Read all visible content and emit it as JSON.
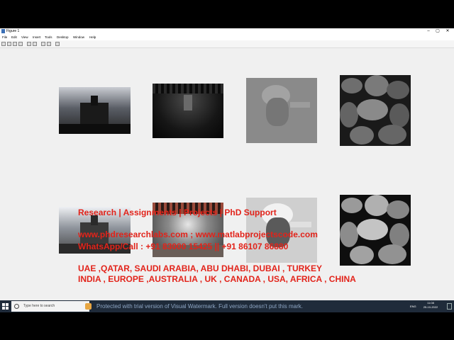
{
  "window": {
    "title": "Figure 1",
    "menu": [
      "File",
      "Edit",
      "View",
      "Insert",
      "Tools",
      "Desktop",
      "Window",
      "Help"
    ],
    "controls": [
      "–",
      "▢",
      "✕"
    ]
  },
  "figure": {
    "row1": [
      "grayscale church photo",
      "dark tunnel bridge",
      "einstein low contrast",
      "coffee beans texture"
    ],
    "row2": [
      "church photo enhanced",
      "bridge enhanced",
      "einstein enhanced",
      "coffee beans enhanced"
    ]
  },
  "overlay": {
    "line1": "Research | Assignments | Projects | PhD Support",
    "line2": "www.phdresearchlabs.com ; www.matlabprojectscode.com",
    "line3": "WhatsApp/Call : +91 83000 15425 || +91 86107 86880",
    "line4": "UAE ,QATAR, SAUDI ARABIA, ABU DHABI, DUBAI , TURKEY",
    "line5": "INDIA , EUROPE ,AUSTRALIA , UK , CANADA , USA, AFRICA , CHINA"
  },
  "taskbar": {
    "search_placeholder": "Type here to search",
    "watermark": "Protected with trial version of Visual Watermark. Full version doesn't put this mark.",
    "lang": "ENG",
    "time": "11:08",
    "date": "25-10-2022"
  },
  "colors": {
    "overlay_text": "#e2231a",
    "taskbar": "#1f2b3a"
  }
}
